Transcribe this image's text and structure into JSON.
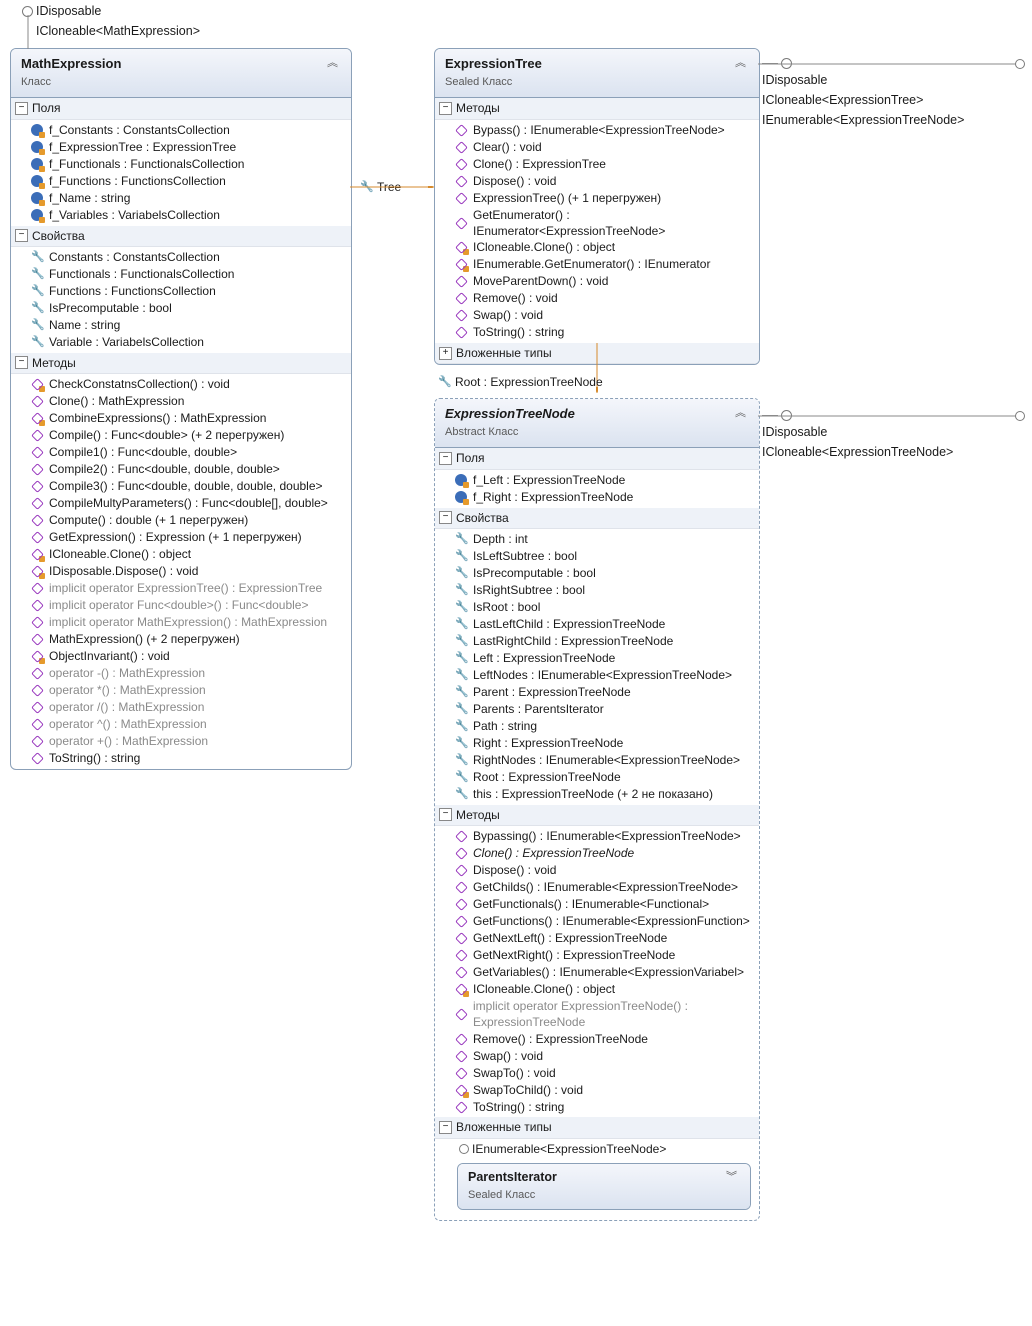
{
  "mathExpression": {
    "interfaces": [
      "IDisposable",
      "ICloneable<MathExpression>"
    ],
    "title": "MathExpression",
    "subtitle": "Класс",
    "sections": {
      "fields": {
        "label": "Поля",
        "items": [
          {
            "t": "f_Constants : ConstantsCollection",
            "k": "field"
          },
          {
            "t": "f_ExpressionTree : ExpressionTree",
            "k": "field"
          },
          {
            "t": "f_Functionals : FunctionalsCollection",
            "k": "field"
          },
          {
            "t": "f_Functions : FunctionsCollection",
            "k": "field"
          },
          {
            "t": "f_Name : string",
            "k": "field"
          },
          {
            "t": "f_Variables : VariabelsCollection",
            "k": "field"
          }
        ]
      },
      "props": {
        "label": "Свойства",
        "items": [
          {
            "t": "Constants : ConstantsCollection",
            "k": "prop"
          },
          {
            "t": "Functionals : FunctionalsCollection",
            "k": "prop"
          },
          {
            "t": "Functions : FunctionsCollection",
            "k": "prop"
          },
          {
            "t": "IsPrecomputable : bool",
            "k": "prop"
          },
          {
            "t": "Name : string",
            "k": "prop"
          },
          {
            "t": "Variable : VariabelsCollection",
            "k": "prop"
          }
        ]
      },
      "methods": {
        "label": "Методы",
        "items": [
          {
            "t": "CheckConstatnsCollection() : void",
            "k": "meth",
            "priv": true
          },
          {
            "t": "Clone() : MathExpression",
            "k": "meth"
          },
          {
            "t": "CombineExpressions() : MathExpression",
            "k": "meth",
            "priv": true
          },
          {
            "t": "Compile() : Func<double> (+ 2 перегружен)",
            "k": "meth"
          },
          {
            "t": "Compile1() : Func<double, double>",
            "k": "meth"
          },
          {
            "t": "Compile2() : Func<double, double, double>",
            "k": "meth"
          },
          {
            "t": "Compile3() : Func<double, double, double, double>",
            "k": "meth"
          },
          {
            "t": "CompileMultyParameters() : Func<double[], double>",
            "k": "meth"
          },
          {
            "t": "Compute() : double (+ 1 перегружен)",
            "k": "meth"
          },
          {
            "t": "GetExpression() : Expression (+ 1 перегружен)",
            "k": "meth"
          },
          {
            "t": "ICloneable.Clone() : object",
            "k": "meth",
            "priv": true
          },
          {
            "t": "IDisposable.Dispose() : void",
            "k": "meth",
            "priv": true
          },
          {
            "t": "implicit operator ExpressionTree() : ExpressionTree",
            "k": "meth",
            "gray": true
          },
          {
            "t": "implicit operator Func<double>() : Func<double>",
            "k": "meth",
            "gray": true
          },
          {
            "t": "implicit operator MathExpression() : MathExpression",
            "k": "meth",
            "gray": true
          },
          {
            "t": "MathExpression() (+ 2 перегружен)",
            "k": "meth"
          },
          {
            "t": "ObjectInvariant() : void",
            "k": "meth",
            "priv": true
          },
          {
            "t": "operator -() : MathExpression",
            "k": "meth",
            "gray": true
          },
          {
            "t": "operator *() : MathExpression",
            "k": "meth",
            "gray": true
          },
          {
            "t": "operator /() : MathExpression",
            "k": "meth",
            "gray": true
          },
          {
            "t": "operator ^() : MathExpression",
            "k": "meth",
            "gray": true
          },
          {
            "t": "operator +() : MathExpression",
            "k": "meth",
            "gray": true
          },
          {
            "t": "ToString() : string",
            "k": "meth"
          }
        ]
      }
    }
  },
  "expressionTree": {
    "interfaces": [
      "IDisposable",
      "ICloneable<ExpressionTree>",
      "IEnumerable<ExpressionTreeNode>"
    ],
    "title": "ExpressionTree",
    "subtitle": "Sealed Класс",
    "methods": {
      "label": "Методы",
      "items": [
        {
          "t": "Bypass() : IEnumerable<ExpressionTreeNode>",
          "k": "meth"
        },
        {
          "t": "Clear() : void",
          "k": "meth"
        },
        {
          "t": "Clone() : ExpressionTree",
          "k": "meth"
        },
        {
          "t": "Dispose() : void",
          "k": "meth"
        },
        {
          "t": "ExpressionTree() (+ 1 перегружен)",
          "k": "meth"
        },
        {
          "t": "GetEnumerator() : IEnumerator<ExpressionTreeNode>",
          "k": "meth"
        },
        {
          "t": "ICloneable.Clone() : object",
          "k": "meth",
          "priv": true
        },
        {
          "t": "IEnumerable.GetEnumerator() : IEnumerator",
          "k": "meth",
          "priv": true
        },
        {
          "t": "MoveParentDown() : void",
          "k": "meth"
        },
        {
          "t": "Remove() : void",
          "k": "meth"
        },
        {
          "t": "Swap() : void",
          "k": "meth"
        },
        {
          "t": "ToString() : string",
          "k": "meth"
        }
      ]
    },
    "nested": {
      "label": "Вложенные типы"
    }
  },
  "expressionTreeNode": {
    "interfaces": [
      "IDisposable",
      "ICloneable<ExpressionTreeNode>"
    ],
    "title": "ExpressionTreeNode",
    "subtitle": "Abstract Класс",
    "italic": true,
    "fields": {
      "label": "Поля",
      "items": [
        {
          "t": "f_Left : ExpressionTreeNode",
          "k": "field"
        },
        {
          "t": "f_Right : ExpressionTreeNode",
          "k": "field"
        }
      ]
    },
    "props": {
      "label": "Свойства",
      "items": [
        {
          "t": "Depth : int",
          "k": "prop"
        },
        {
          "t": "IsLeftSubtree : bool",
          "k": "prop"
        },
        {
          "t": "IsPrecomputable : bool",
          "k": "prop"
        },
        {
          "t": "IsRightSubtree : bool",
          "k": "prop"
        },
        {
          "t": "IsRoot : bool",
          "k": "prop"
        },
        {
          "t": "LastLeftChild : ExpressionTreeNode",
          "k": "prop"
        },
        {
          "t": "LastRightChild : ExpressionTreeNode",
          "k": "prop"
        },
        {
          "t": "Left : ExpressionTreeNode",
          "k": "prop"
        },
        {
          "t": "LeftNodes : IEnumerable<ExpressionTreeNode>",
          "k": "prop"
        },
        {
          "t": "Parent : ExpressionTreeNode",
          "k": "prop"
        },
        {
          "t": "Parents : ParentsIterator",
          "k": "prop"
        },
        {
          "t": "Path : string",
          "k": "prop"
        },
        {
          "t": "Right : ExpressionTreeNode",
          "k": "prop"
        },
        {
          "t": "RightNodes : IEnumerable<ExpressionTreeNode>",
          "k": "prop"
        },
        {
          "t": "Root : ExpressionTreeNode",
          "k": "prop"
        },
        {
          "t": "this : ExpressionTreeNode (+ 2 не показано)",
          "k": "prop"
        }
      ]
    },
    "methods": {
      "label": "Методы",
      "items": [
        {
          "t": "Bypassing() : IEnumerable<ExpressionTreeNode>",
          "k": "meth"
        },
        {
          "t": "Clone() : ExpressionTreeNode",
          "k": "meth",
          "ital": true
        },
        {
          "t": "Dispose() : void",
          "k": "meth"
        },
        {
          "t": "GetChilds() : IEnumerable<ExpressionTreeNode>",
          "k": "meth"
        },
        {
          "t": "GetFunctionals() : IEnumerable<Functional>",
          "k": "meth"
        },
        {
          "t": "GetFunctions() : IEnumerable<ExpressionFunction>",
          "k": "meth"
        },
        {
          "t": "GetNextLeft() : ExpressionTreeNode",
          "k": "meth"
        },
        {
          "t": "GetNextRight() : ExpressionTreeNode",
          "k": "meth"
        },
        {
          "t": "GetVariables() : IEnumerable<ExpressionVariabel>",
          "k": "meth"
        },
        {
          "t": "ICloneable.Clone() : object",
          "k": "meth",
          "priv": true
        },
        {
          "t": "implicit operator ExpressionTreeNode() : ExpressionTreeNode",
          "k": "meth",
          "gray": true
        },
        {
          "t": "Remove() : ExpressionTreeNode",
          "k": "meth"
        },
        {
          "t": "Swap() : void",
          "k": "meth"
        },
        {
          "t": "SwapTo() : void",
          "k": "meth"
        },
        {
          "t": "SwapToChild() : void",
          "k": "meth",
          "priv": true
        },
        {
          "t": "ToString() : string",
          "k": "meth"
        }
      ]
    },
    "nestedSect": "Вложенные типы",
    "nestedIface": "IEnumerable<ExpressionTreeNode>",
    "nested": {
      "title": "ParentsIterator",
      "subtitle": "Sealed Класс"
    }
  },
  "labels": {
    "tree": "Tree",
    "root": "Root : ExpressionTreeNode"
  }
}
